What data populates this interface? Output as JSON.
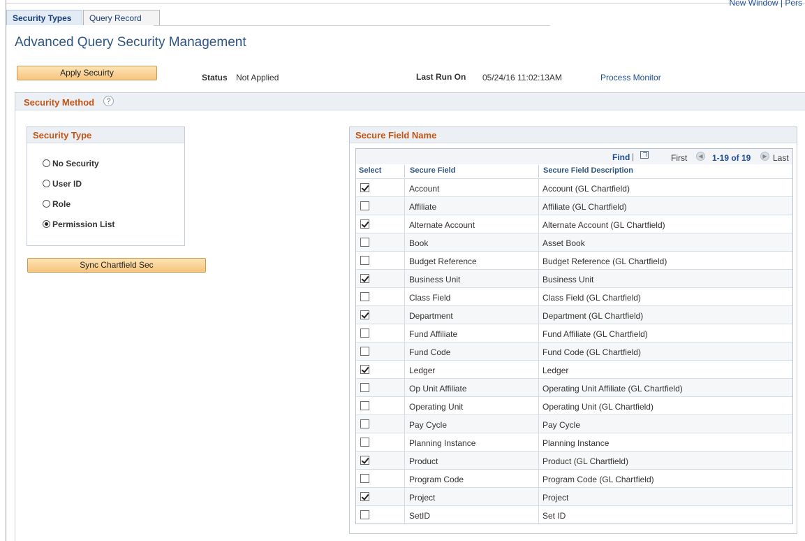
{
  "top_links": {
    "new_window": "New Window",
    "separator": "|",
    "personalize": "Pers"
  },
  "tabs": [
    {
      "label": "Security Types",
      "active": true
    },
    {
      "label": "Query Record",
      "active": false
    }
  ],
  "page_title": "Advanced Query Security Management",
  "apply_button": "Apply Secuirty",
  "status": {
    "label": "Status",
    "value": "Not Applied"
  },
  "last_run": {
    "label": "Last Run On",
    "value": "05/24/16 11:02:13AM"
  },
  "process_monitor": "Process Monitor",
  "security_method": {
    "title": "Security Method",
    "help_icon": "?"
  },
  "security_type": {
    "title": "Security Type",
    "options": [
      {
        "label": "No Security",
        "selected": false
      },
      {
        "label": "User ID",
        "selected": false
      },
      {
        "label": "Role",
        "selected": false
      },
      {
        "label": "Permission List",
        "selected": true
      }
    ]
  },
  "sync_button": "Sync Chartfield Sec",
  "secure_field_grid": {
    "title": "Secure Field Name",
    "find": "Find",
    "find_separator": "|",
    "first": "First",
    "range": "1-19 of 19",
    "last": "Last",
    "columns": [
      "Select",
      "Secure Field",
      "Secure Field Description"
    ],
    "rows": [
      {
        "selected": true,
        "field": "Account",
        "description": "Account (GL Chartfield)"
      },
      {
        "selected": false,
        "field": "Affiliate",
        "description": "Affiliate (GL Chartfield)"
      },
      {
        "selected": true,
        "field": "Alternate Account",
        "description": "Alternate Account (GL Chartfield)"
      },
      {
        "selected": false,
        "field": "Book",
        "description": "Asset Book"
      },
      {
        "selected": false,
        "field": "Budget Reference",
        "description": "Budget Reference (GL Chartfield)"
      },
      {
        "selected": true,
        "field": "Business Unit",
        "description": "Business Unit"
      },
      {
        "selected": false,
        "field": "Class Field",
        "description": "Class Field (GL Chartfield)"
      },
      {
        "selected": true,
        "field": "Department",
        "description": "Department (GL Chartfield)"
      },
      {
        "selected": false,
        "field": "Fund Affiliate",
        "description": "Fund Affiliate (GL Chartfield)"
      },
      {
        "selected": false,
        "field": "Fund Code",
        "description": "Fund Code (GL Chartfield)"
      },
      {
        "selected": true,
        "field": "Ledger",
        "description": "Ledger"
      },
      {
        "selected": false,
        "field": "Op Unit Affiliate",
        "description": "Operating Unit Affiliate (GL Chartfield)"
      },
      {
        "selected": false,
        "field": "Operating Unit",
        "description": "Operating Unit (GL Chartfield)"
      },
      {
        "selected": false,
        "field": "Pay Cycle",
        "description": "Pay Cycle"
      },
      {
        "selected": false,
        "field": "Planning Instance",
        "description": "Planning Instance"
      },
      {
        "selected": true,
        "field": "Product",
        "description": "Product (GL Chartfield)"
      },
      {
        "selected": false,
        "field": "Program Code",
        "description": "Program Code (GL Chartfield)"
      },
      {
        "selected": true,
        "field": "Project",
        "description": "Project"
      },
      {
        "selected": false,
        "field": "SetID",
        "description": "Set ID"
      }
    ]
  }
}
